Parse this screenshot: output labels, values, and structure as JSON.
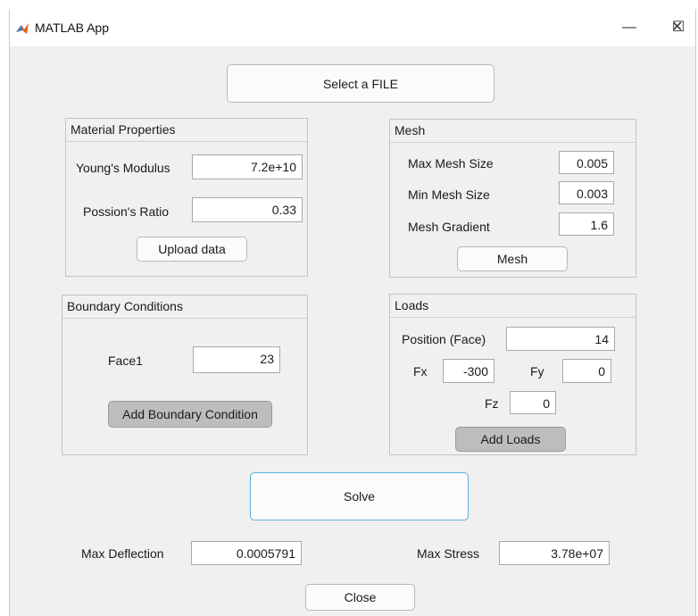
{
  "window": {
    "title": "MATLAB App",
    "minimize": "—",
    "maximize": "☐",
    "close": "✕"
  },
  "select_file_label": "Select a FILE",
  "material": {
    "title": "Material Properties",
    "youngs_label": "Young's Modulus",
    "youngs_value": "7.2e+10",
    "poisson_label": "Possion's Ratio",
    "poisson_value": "0.33",
    "upload_label": "Upload data"
  },
  "mesh": {
    "title": "Mesh",
    "max_label": "Max Mesh Size",
    "max_value": "0.005",
    "min_label": "Min Mesh Size",
    "min_value": "0.003",
    "gradient_label": "Mesh Gradient",
    "gradient_value": "1.6",
    "mesh_button": "Mesh"
  },
  "boundary": {
    "title": "Boundary Conditions",
    "face_label": "Face1",
    "face_value": "23",
    "add_label": "Add Boundary Condition"
  },
  "loads": {
    "title": "Loads",
    "position_label": "Position (Face)",
    "position_value": "14",
    "fx_label": "Fx",
    "fx_value": "-300",
    "fy_label": "Fy",
    "fy_value": "0",
    "fz_label": "Fz",
    "fz_value": "0",
    "add_label": "Add Loads"
  },
  "solve_label": "Solve",
  "results": {
    "deflection_label": "Max Deflection",
    "deflection_value": "0.0005791",
    "stress_label": "Max Stress",
    "stress_value": "3.78e+07"
  },
  "close_label": "Close"
}
